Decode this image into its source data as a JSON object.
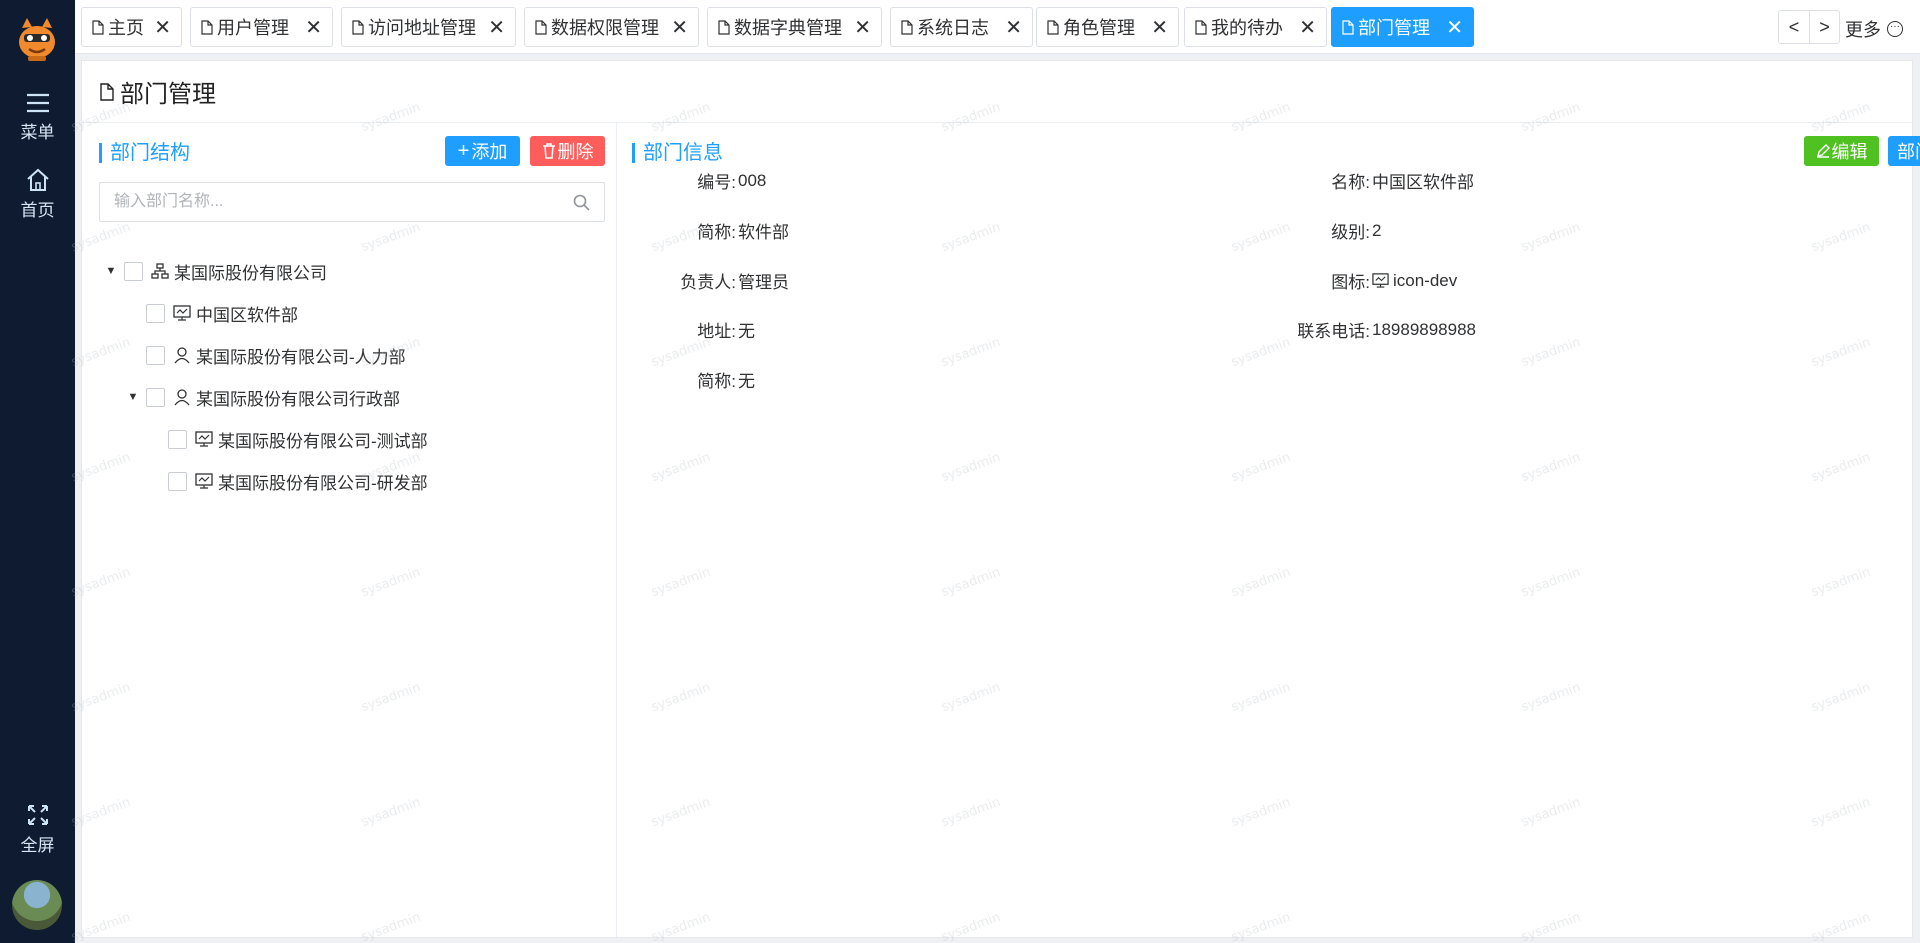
{
  "sidebar": {
    "menu_label": "菜单",
    "home_label": "首页",
    "fullscreen_label": "全屏"
  },
  "tabs": [
    {
      "label": "主页",
      "active": false
    },
    {
      "label": "用户管理",
      "active": false
    },
    {
      "label": "访问地址管理",
      "active": false
    },
    {
      "label": "数据权限管理",
      "active": false
    },
    {
      "label": "数据字典管理",
      "active": false
    },
    {
      "label": "系统日志",
      "active": false
    },
    {
      "label": "角色管理",
      "active": false
    },
    {
      "label": "我的待办",
      "active": false
    },
    {
      "label": "部门管理",
      "active": true
    }
  ],
  "tab_nav": {
    "prev": "<",
    "next": ">",
    "more": "更多"
  },
  "page": {
    "title": "部门管理"
  },
  "structure": {
    "title": "部门结构",
    "add_label": "添加",
    "delete_label": "删除",
    "search_placeholder": "输入部门名称...",
    "nodes": [
      {
        "label": "某国际股份有限公司",
        "icon": "org-icon",
        "expanded": true
      },
      {
        "label": "中国区软件部",
        "icon": "monitor-icon"
      },
      {
        "label": "某国际股份有限公司-人力部",
        "icon": "user-icon"
      },
      {
        "label": "某国际股份有限公司行政部",
        "icon": "user-icon",
        "expanded": true
      },
      {
        "label": "某国际股份有限公司-测试部",
        "icon": "monitor-icon"
      },
      {
        "label": "某国际股份有限公司-研发部",
        "icon": "monitor-icon"
      }
    ]
  },
  "info": {
    "title": "部门信息",
    "edit_label": "编辑",
    "members_label": "部门人员",
    "fields": {
      "code_label": "编号:",
      "code_value": "008",
      "name_label": "名称:",
      "name_value": "中国区软件部",
      "short_label": "简称:",
      "short_value": "软件部",
      "level_label": "级别:",
      "level_value": "2",
      "leader_label": "负责人:",
      "leader_value": "管理员",
      "icon_label": "图标:",
      "icon_value": "icon-dev",
      "address_label": "地址:",
      "address_value": "无",
      "phone_label": "联系电话:",
      "phone_value": "18989898988",
      "short2_label": "简称:",
      "short2_value": "无"
    }
  },
  "watermark_text": "sysadmin",
  "colors": {
    "sidebar_bg": "#0e1b30",
    "accent": "#1e9fff",
    "danger": "#ff5c5c",
    "success": "#4fc222"
  }
}
